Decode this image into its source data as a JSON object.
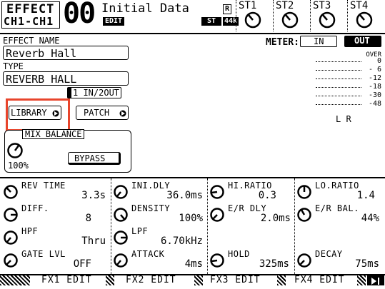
{
  "header": {
    "effect_label": "EFFECT",
    "channel_label": "CH1-CH1",
    "number": "00",
    "scene_title": "Initial Data",
    "edit_badge": "EDIT",
    "st_badge": "ST",
    "rate_badge": "44k",
    "r_badge": "R",
    "stereo_outs": [
      "ST1",
      "ST2",
      "ST3",
      "ST4"
    ]
  },
  "left": {
    "effect_name_label": "EFFECT NAME",
    "effect_name_value": "Reverb Hall",
    "type_label": "TYPE",
    "type_value": "REVERB HALL",
    "io_label": "1 IN/2OUT",
    "library_button": "LIBRARY",
    "patch_button": "PATCH",
    "mix_balance_label": "MIX BALANCE",
    "mix_balance_value": "100%",
    "bypass_button": "BYPASS"
  },
  "meter": {
    "label": "METER:",
    "in_button": "IN",
    "out_button": "OUT",
    "scale": [
      "OVER",
      "0",
      "- 6",
      "-12",
      "-18",
      "-30",
      "-48"
    ],
    "channels": "L R"
  },
  "params": [
    {
      "name": "REV TIME",
      "value": "3.3s"
    },
    {
      "name": "INI.DLY",
      "value": "36.0ms"
    },
    {
      "name": "HI.RATIO",
      "value": "0.3"
    },
    {
      "name": "LO.RATIO",
      "value": "1.4"
    },
    {
      "name": "DIFF.",
      "value": "8"
    },
    {
      "name": "DENSITY",
      "value": "100%"
    },
    {
      "name": "E/R DLY",
      "value": "2.0ms"
    },
    {
      "name": "E/R BAL.",
      "value": "44%"
    },
    {
      "name": "HPF",
      "value": "Thru"
    },
    {
      "name": "LPF",
      "value": "6.70kHz"
    },
    {
      "name": "",
      "value": ""
    },
    {
      "name": "",
      "value": ""
    },
    {
      "name": "GATE LVL",
      "value": "OFF"
    },
    {
      "name": "ATTACK",
      "value": "4ms"
    },
    {
      "name": "HOLD",
      "value": "325ms"
    },
    {
      "name": "DECAY",
      "value": "75ms"
    }
  ],
  "tabs": [
    "FX1 EDIT",
    "FX2 EDIT",
    "FX3 EDIT",
    "FX4 EDIT"
  ],
  "highlight_color": "#e8452c"
}
